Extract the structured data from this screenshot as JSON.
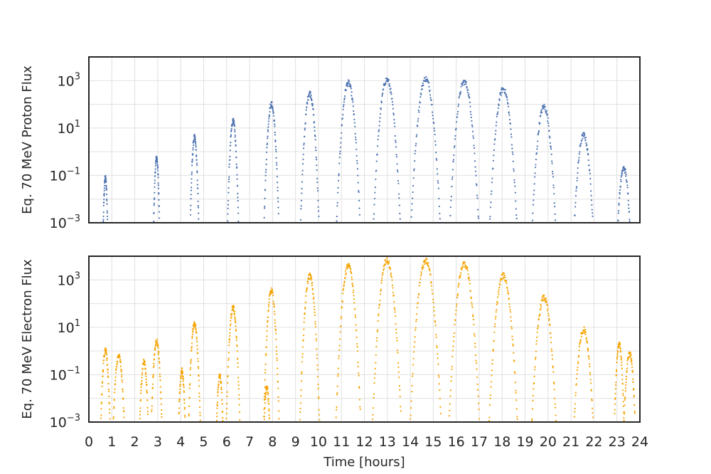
{
  "chart_data": [
    {
      "type": "scatter",
      "ylabel": "Eq. 70 MeV Proton Flux",
      "xlabel": "",
      "xlim": [
        0,
        24
      ],
      "ylim_log10": [
        -3,
        4
      ],
      "yscale": "log",
      "grid": true,
      "color": "#4c72b0",
      "y_ticks": [
        {
          "exp": 3,
          "label_base": "10",
          "label_exp": "3"
        },
        {
          "exp": 1,
          "label_base": "10",
          "label_exp": "1"
        },
        {
          "exp": -1,
          "label_base": "10",
          "label_exp": "−1"
        },
        {
          "exp": -3,
          "label_base": "10",
          "label_exp": "−3"
        }
      ],
      "passes": [
        {
          "center": 0.72,
          "peak": 0.08,
          "width": 0.07
        },
        {
          "center": 2.95,
          "peak": 0.55,
          "width": 0.08
        },
        {
          "center": 4.6,
          "peak": 4,
          "width": 0.1
        },
        {
          "center": 6.28,
          "peak": 20,
          "width": 0.12
        },
        {
          "center": 7.95,
          "peak": 100,
          "width": 0.15
        },
        {
          "center": 9.62,
          "peak": 300,
          "width": 0.18
        },
        {
          "center": 11.3,
          "peak": 800,
          "width": 0.22
        },
        {
          "center": 12.98,
          "peak": 1100,
          "width": 0.25
        },
        {
          "center": 14.67,
          "peak": 1200,
          "width": 0.27
        },
        {
          "center": 16.35,
          "peak": 900,
          "width": 0.27
        },
        {
          "center": 18.05,
          "peak": 450,
          "width": 0.26
        },
        {
          "center": 19.82,
          "peak": 80,
          "width": 0.24
        },
        {
          "center": 21.55,
          "peak": 5,
          "width": 0.22
        },
        {
          "center": 23.3,
          "peak": 0.2,
          "width": 0.18
        }
      ]
    },
    {
      "type": "scatter",
      "ylabel": "Eq. 70 MeV Electron Flux",
      "xlabel": "Time [hours]",
      "xlim": [
        0,
        24
      ],
      "ylim_log10": [
        -3,
        4
      ],
      "yscale": "log",
      "grid": true,
      "color": "#f5a300",
      "x_ticks": [
        "0",
        "1",
        "2",
        "3",
        "4",
        "5",
        "6",
        "7",
        "8",
        "9",
        "10",
        "11",
        "12",
        "13",
        "14",
        "15",
        "16",
        "17",
        "18",
        "19",
        "20",
        "21",
        "22",
        "23",
        "24"
      ],
      "y_ticks": [
        {
          "exp": 3,
          "label_base": "10",
          "label_exp": "3"
        },
        {
          "exp": 1,
          "label_base": "10",
          "label_exp": "1"
        },
        {
          "exp": -1,
          "label_base": "10",
          "label_exp": "−1"
        },
        {
          "exp": -3,
          "label_base": "10",
          "label_exp": "−3"
        }
      ],
      "passes": [
        {
          "center": 0.72,
          "peak": 1.0,
          "width": 0.12
        },
        {
          "center": 1.3,
          "peak": 0.6,
          "width": 0.15
        },
        {
          "center": 2.4,
          "peak": 0.35,
          "width": 0.12
        },
        {
          "center": 2.95,
          "peak": 2.5,
          "width": 0.13
        },
        {
          "center": 4.05,
          "peak": 0.15,
          "width": 0.1
        },
        {
          "center": 4.6,
          "peak": 15,
          "width": 0.13
        },
        {
          "center": 5.7,
          "peak": 0.09,
          "width": 0.1
        },
        {
          "center": 6.28,
          "peak": 70,
          "width": 0.14
        },
        {
          "center": 7.75,
          "peak": 0.03,
          "width": 0.1
        },
        {
          "center": 7.95,
          "peak": 350,
          "width": 0.15
        },
        {
          "center": 9.62,
          "peak": 1500,
          "width": 0.18
        },
        {
          "center": 11.3,
          "peak": 4000,
          "width": 0.22
        },
        {
          "center": 12.98,
          "peak": 6500,
          "width": 0.25
        },
        {
          "center": 14.67,
          "peak": 6500,
          "width": 0.27
        },
        {
          "center": 16.35,
          "peak": 4500,
          "width": 0.27
        },
        {
          "center": 18.05,
          "peak": 1500,
          "width": 0.26
        },
        {
          "center": 19.82,
          "peak": 180,
          "width": 0.24
        },
        {
          "center": 21.55,
          "peak": 8,
          "width": 0.22
        },
        {
          "center": 23.1,
          "peak": 2,
          "width": 0.12
        },
        {
          "center": 23.55,
          "peak": 0.8,
          "width": 0.15
        }
      ]
    }
  ]
}
